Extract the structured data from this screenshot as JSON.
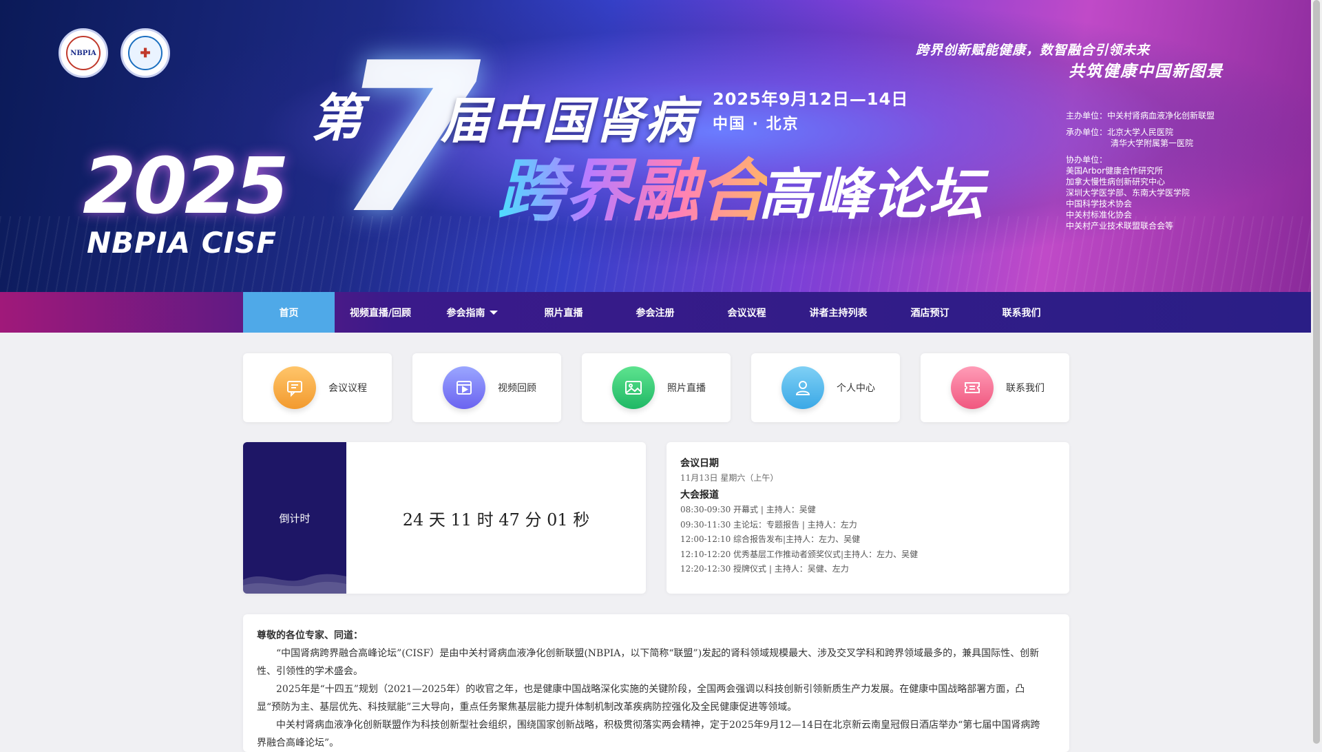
{
  "banner": {
    "logo1_text": "NBPIA",
    "year": "2025",
    "year_sub": "NBPIA CISF",
    "title_di": "第",
    "title_num": "7",
    "title_main": "届中国肾病",
    "title_calli": "跨界融合",
    "title_forum": "高峰论坛",
    "date": "2025年9月12日—14日",
    "place": "中国 · 北京",
    "slogan1": "跨界创新赋能健康，数智融合引领未来",
    "slogan2": "共筑健康中国新图景",
    "orgs": {
      "host": "主办单位：中关村肾病血液净化创新联盟",
      "organizer_label": "承办单位：北京大学人民医院",
      "organizer_2": "清华大学附属第一医院",
      "co_label": "协办单位：",
      "co": [
        "美国Arbor健康合作研究所",
        "加拿大慢性病创新研究中心",
        "深圳大学医学部、东南大学医学院",
        "中国科学技术协会",
        "中关村标准化协会",
        "中关村产业技术联盟联合会等"
      ]
    }
  },
  "nav": {
    "items": [
      "首页",
      "视频直播/回顾",
      "参会指南",
      "照片直播",
      "参会注册",
      "会议议程",
      "讲者主持列表",
      "酒店预订",
      "联系我们"
    ]
  },
  "cards": [
    {
      "label": "会议议程",
      "icon": "chat-icon",
      "color1": "#ffc56a",
      "color2": "#f29a2e"
    },
    {
      "label": "视频回顾",
      "icon": "video-icon",
      "color1": "#9aa6ff",
      "color2": "#6b63f0"
    },
    {
      "label": "照片直播",
      "icon": "image-icon",
      "color1": "#5ee38f",
      "color2": "#1fb865"
    },
    {
      "label": "个人中心",
      "icon": "user-icon",
      "color1": "#7fd0f5",
      "color2": "#3aa8e6"
    },
    {
      "label": "联系我们",
      "icon": "ticket-icon",
      "color1": "#ff9cb7",
      "color2": "#f0577f"
    }
  ],
  "countdown": {
    "label": "倒计时",
    "value": "24 天 11 时 47 分 01 秒"
  },
  "schedule": {
    "title": "会议日期",
    "day": "11月13日 星期六（上午）",
    "section": "大会报道",
    "rows": [
      "08:30-09:30 开幕式 | 主持人：吴健",
      "09:30-11:30 主论坛：专题报告 | 主持人：左力",
      "12:00-12:10 综合报告发布|主持人：左力、吴健",
      "12:10-12:20 优秀基层工作推动者颁奖仪式|主持人：左力、吴健",
      "12:20-12:30 授牌仪式 | 主持人：吴健、左力"
    ]
  },
  "intro": {
    "greeting": "尊敬的各位专家、同道：",
    "paragraphs": [
      "“中国肾病跨界融合高峰论坛”(CISF）是由中关村肾病血液净化创新联盟(NBPIA，以下简称“联盟”)发起的肾科领域规模最大、涉及交叉学科和跨界领域最多的，兼具国际性、创新性、引领性的学术盛会。",
      "2025年是“十四五”规划（2021—2025年）的收官之年，也是健康中国战略深化实施的关键阶段，全国两会强调以科技创新引领新质生产力发展。在健康中国战略部署方面，凸显“预防为主、基层优先、科技赋能”三大导向，重点任务聚焦基层能力提升体制机制改革疾病防控强化及全民健康促进等领域。",
      "中关村肾病血液净化创新联盟作为科技创新型社会组织，围绕国家创新战略，积极贯彻落实两会精神，定于2025年9月12—14日在北京新云南皇冠假日酒店举办“第七届中国肾病跨界融合高峰论坛”。"
    ]
  }
}
